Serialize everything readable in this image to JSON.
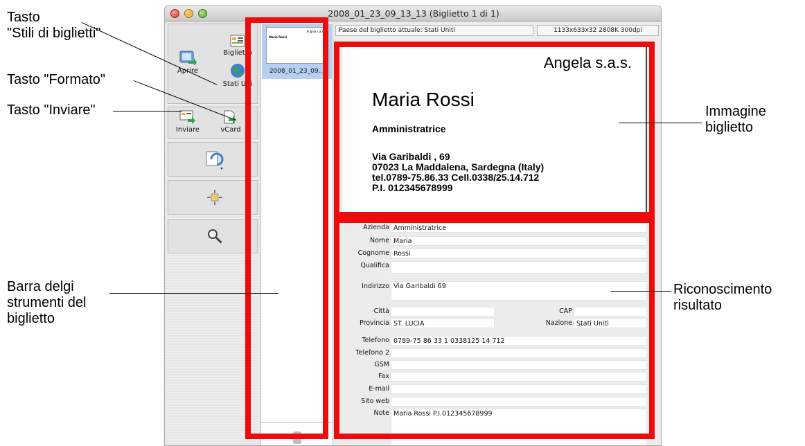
{
  "annotations": {
    "stili": "Tasto\n\"Stili di biglietti\"",
    "formato": "Tasto \"Formato\"",
    "inviare": "Tasto \"Inviare\"",
    "barra": "Barra delgi\nstrumenti del\nbiglietto",
    "immagine": "Immagine\nbiglietto",
    "riconoscimento": "Riconoscimento\nrisultato"
  },
  "window": {
    "title": "2008_01_23_09_13_13 (Biglietto 1 di 1)"
  },
  "toolbar": {
    "open_label": "Aprire",
    "style_label": "Biglietto",
    "country_label": "Stati Uni",
    "send_label": "Inviare",
    "vcard_label": "vCard"
  },
  "thumbnails": [
    {
      "label": "2008_01_23_09...",
      "mini_company": "Angela s.a.s.",
      "mini_name": "Maria Rossi"
    }
  ],
  "info": {
    "country_text": "Paese del biglietto attuale: Stati Uniti",
    "image_info": "1133x633x32  2808K  300dpi"
  },
  "card": {
    "company": "Angela s.a.s.",
    "name": "Maria Rossi",
    "role": "Amministratrice",
    "address_lines": [
      "Via Garibaldi , 69",
      "07023 La Maddalena, Sardegna (Italy)",
      "tel.0789-75.86.33   Cell.0338/25.14.712",
      "P.I. 012345678999"
    ]
  },
  "form": {
    "azienda_label": "Azienda",
    "azienda_value": "Amministratrice",
    "nome_label": "Nome",
    "nome_value": "Maria",
    "cognome_label": "Cognome",
    "cognome_value": "Rossi",
    "qualifica_label": "Qualifica",
    "qualifica_value": "",
    "indirizzo_label": "Indirizzo",
    "indirizzo_value": "Via Garibaldi  69",
    "citta_label": "Città",
    "citta_value": "",
    "cap_label": "CAP",
    "cap_value": "",
    "provincia_label": "Provincia",
    "provincia_value": "ST. LUCIA",
    "nazione_label": "Nazione",
    "nazione_value": "Stati Uniti",
    "telefono_label": "Telefono",
    "telefono_value": "0789-75 86 33 1 0338125 14 712",
    "telefono2_label": "Telefono 2",
    "telefono2_value": "",
    "gsm_label": "GSM",
    "gsm_value": "",
    "fax_label": "Fax",
    "fax_value": "",
    "email_label": "E-mail",
    "email_value": "",
    "sitoweb_label": "Sito web",
    "sitoweb_value": "",
    "note_label": "Note",
    "note_value": "Maria Rossi P.I.012345678999"
  },
  "colors": {
    "highlight": "#ee0b0b",
    "selection": "#b7cff2"
  },
  "icons": [
    "open-icon",
    "card-style-icon",
    "globe-icon",
    "send-icon",
    "vcard-icon",
    "rotate-icon",
    "crop-icon",
    "magnifier-icon",
    "trash-icon"
  ]
}
